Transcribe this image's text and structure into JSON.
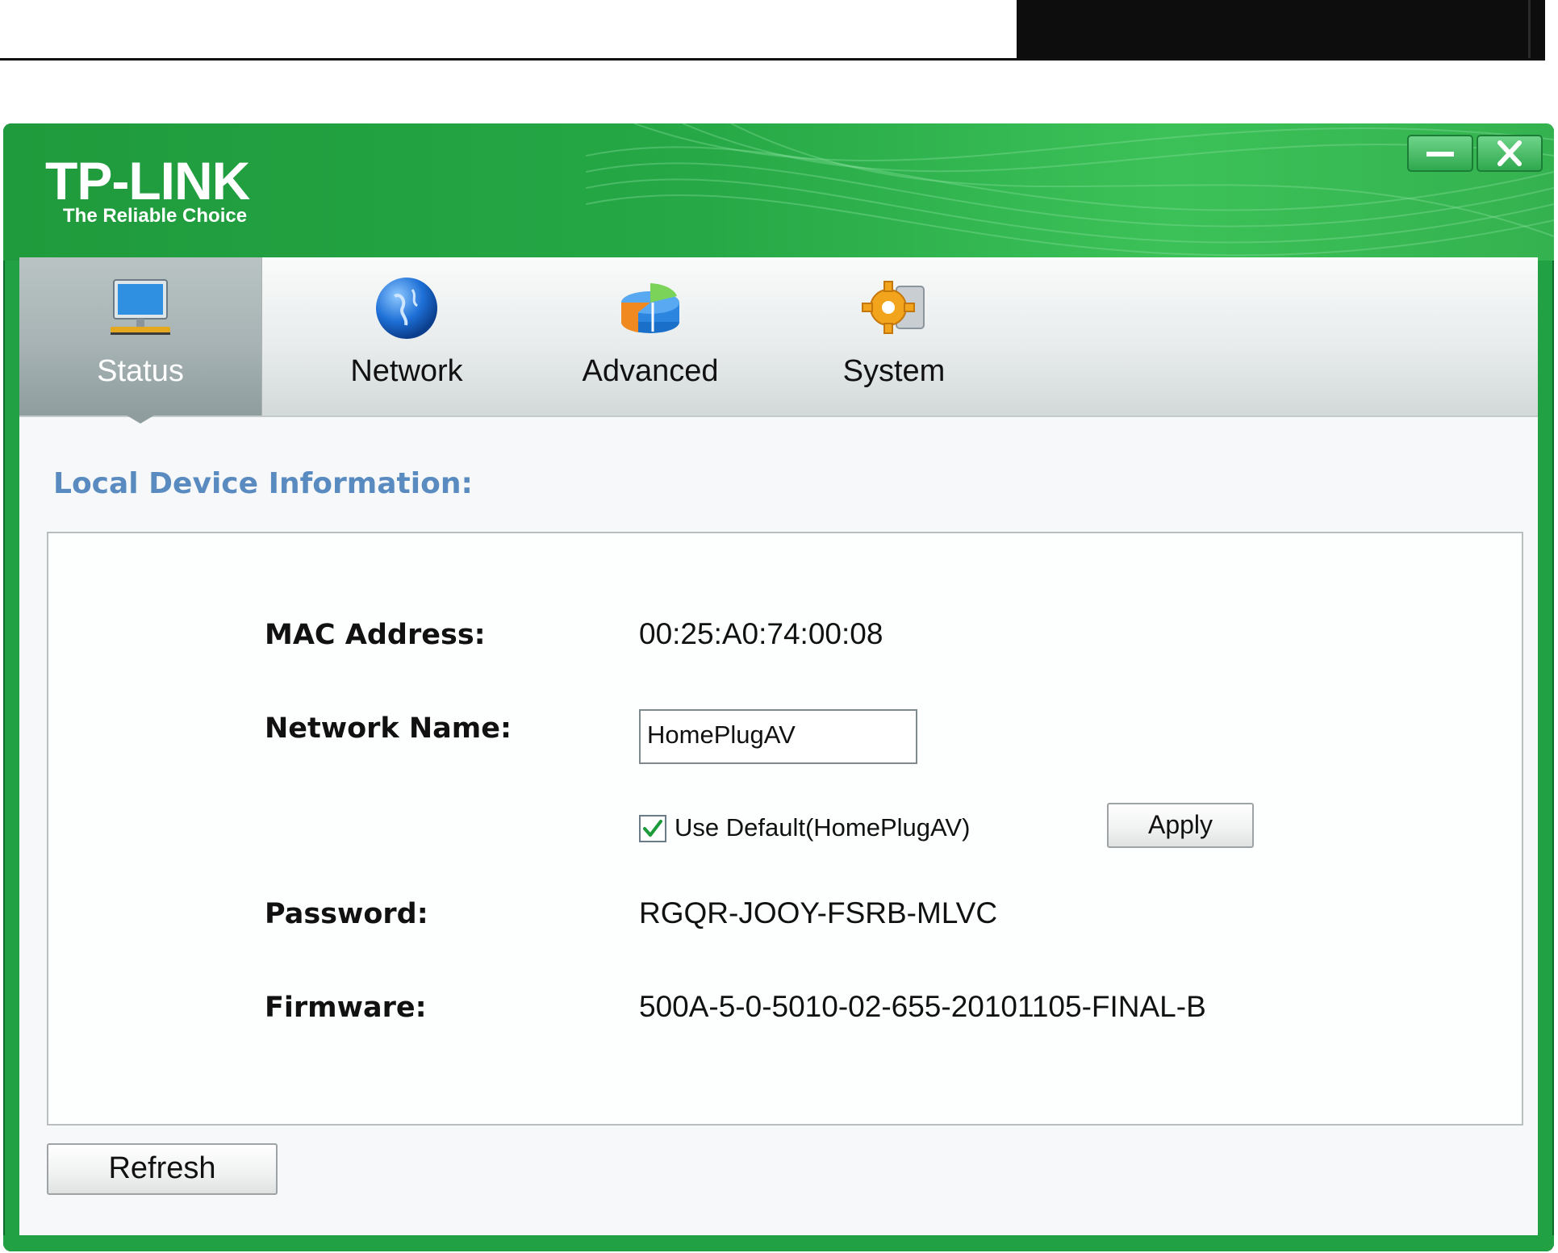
{
  "app": {
    "brand": "TP-LINK",
    "tagline": "The Reliable Choice"
  },
  "window_controls": {
    "minimize_icon": "minimize-icon",
    "close_icon": "close-icon"
  },
  "tabs": [
    {
      "label": "Status",
      "icon": "monitor-icon",
      "active": true
    },
    {
      "label": "Network",
      "icon": "globe-icon",
      "active": false
    },
    {
      "label": "Advanced",
      "icon": "pie-chart-icon",
      "active": false
    },
    {
      "label": "System",
      "icon": "gear-icon",
      "active": false
    }
  ],
  "section": {
    "title": "Local Device Information:"
  },
  "fields": {
    "mac_label": "MAC  Address:",
    "mac_value": "00:25:A0:74:00:08",
    "network_name_label": "Network Name:",
    "network_name_value": "HomePlugAV",
    "use_default_label": "Use Default(HomePlugAV)",
    "use_default_checked": true,
    "password_label": "Password:",
    "password_value": "RGQR-JOOY-FSRB-MLVC",
    "firmware_label": "Firmware:",
    "firmware_value": "500A-5-0-5010-02-655-20101105-FINAL-B"
  },
  "buttons": {
    "apply": "Apply",
    "refresh": "Refresh"
  },
  "colors": {
    "brand_green": "#21a044",
    "section_title": "#5a8bc0"
  }
}
